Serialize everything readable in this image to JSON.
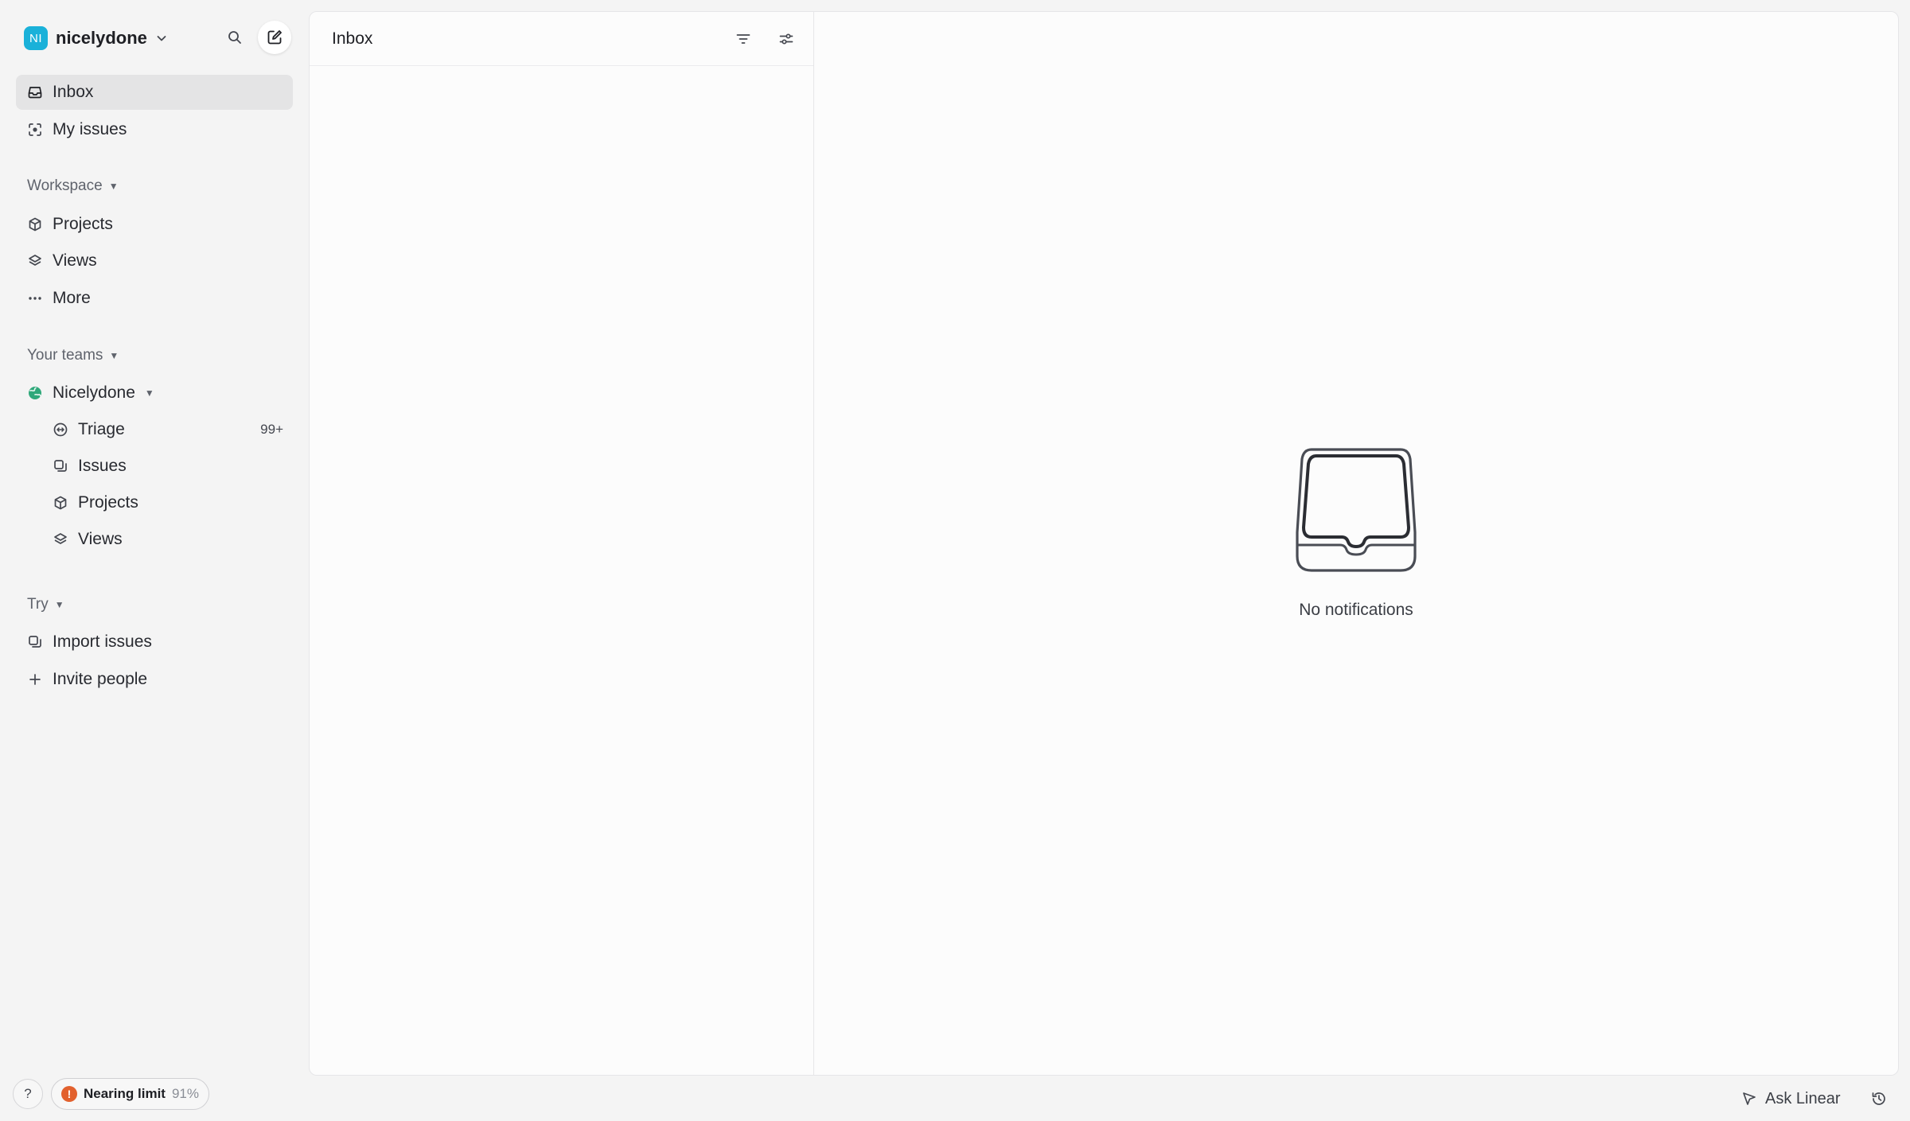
{
  "workspace": {
    "avatar_initials": "NI",
    "name": "nicelydone",
    "avatar_color": "#1ab1d9"
  },
  "header_icons": {
    "search": "search-icon",
    "compose": "compose-icon"
  },
  "nav": {
    "inbox": "Inbox",
    "my_issues": "My issues"
  },
  "workspace_section": {
    "label": "Workspace",
    "items": [
      "Projects",
      "Views",
      "More"
    ]
  },
  "teams_section": {
    "label": "Your teams",
    "team_name": "Nicelydone",
    "items": [
      {
        "label": "Triage",
        "count": "99+"
      },
      {
        "label": "Issues"
      },
      {
        "label": "Projects"
      },
      {
        "label": "Views"
      }
    ]
  },
  "try_section": {
    "label": "Try",
    "items": [
      "Import issues",
      "Invite people"
    ]
  },
  "footer": {
    "help": "?",
    "limit_label": "Nearing limit",
    "limit_percent": "91%",
    "limit_value": 0.91,
    "warn_color": "#e2612e"
  },
  "inbox_pane": {
    "title": "Inbox"
  },
  "empty_state": {
    "message": "No notifications"
  },
  "bottom_bar": {
    "ask_label": "Ask Linear"
  }
}
